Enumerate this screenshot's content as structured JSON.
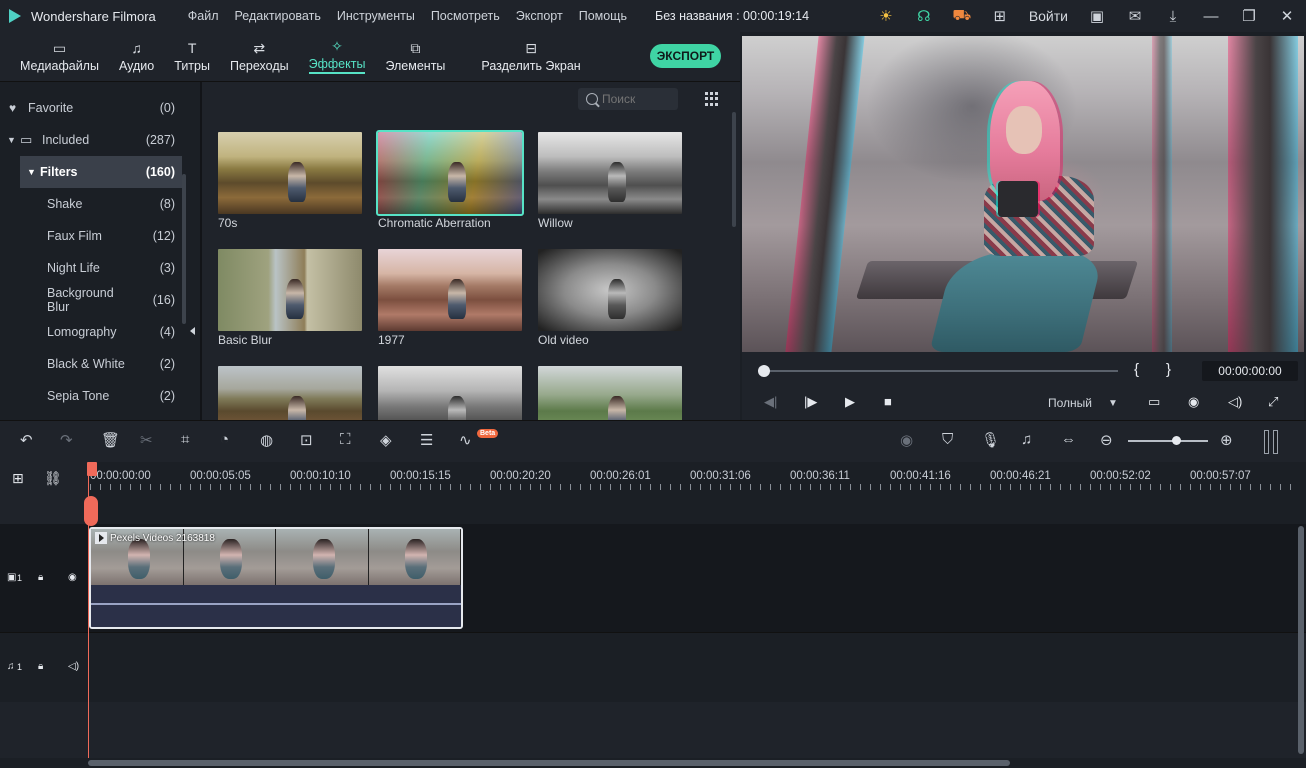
{
  "app": {
    "name": "Wondershare Filmora",
    "doc_title": "Без названия : 00:00:19:14",
    "login": "Войти"
  },
  "menu": [
    "Файл",
    "Редактировать",
    "Инструменты",
    "Посмотреть",
    "Экспорт",
    "Помощь"
  ],
  "tabs": [
    {
      "label": "Медиафайлы",
      "icon": "folder-icon"
    },
    {
      "label": "Аудио",
      "icon": "music-note-icon"
    },
    {
      "label": "Титры",
      "icon": "text-icon"
    },
    {
      "label": "Переходы",
      "icon": "transition-icon"
    },
    {
      "label": "Эффекты",
      "icon": "effects-icon",
      "active": true
    },
    {
      "label": "Элементы",
      "icon": "elements-icon"
    },
    {
      "label": "Разделить Экран",
      "icon": "split-screen-icon"
    }
  ],
  "export_label": "ЭКСПОРТ",
  "categories": [
    {
      "label": "Favorite",
      "count": "(0)"
    },
    {
      "label": "Included",
      "count": "(287)"
    },
    {
      "label": "Filters",
      "count": "(160)"
    },
    {
      "label": "Shake",
      "count": "(8)"
    },
    {
      "label": "Faux Film",
      "count": "(12)"
    },
    {
      "label": "Night Life",
      "count": "(3)"
    },
    {
      "label": "Background Blur",
      "count": "(16)"
    },
    {
      "label": "Lomography",
      "count": "(4)"
    },
    {
      "label": "Black & White",
      "count": "(2)"
    },
    {
      "label": "Sepia Tone",
      "count": "(2)"
    }
  ],
  "search": {
    "placeholder": "Поиск"
  },
  "effects": [
    "70s",
    "Chromatic Aberration",
    "Willow",
    "Basic Blur",
    "1977",
    "Old video"
  ],
  "preview": {
    "timecode": "00:00:00:00",
    "quality": "Полный",
    "brace_open": "{",
    "brace_close": "}"
  },
  "timeline": {
    "beta_label": "Beta",
    "ticks": [
      "00:00:00:00",
      "00:00:05:05",
      "00:00:10:10",
      "00:00:15:15",
      "00:00:20:20",
      "00:00:26:01",
      "00:00:31:06",
      "00:00:36:11",
      "00:00:41:16",
      "00:00:46:21",
      "00:00:52:02",
      "00:00:57:07"
    ],
    "video_track_label": "1",
    "audio_track_label": "1",
    "clip_name": "Pexels Videos 2163818"
  },
  "colors": {
    "accent": "#57e3c6",
    "export": "#3fd4a4",
    "playhead": "#f06a5a"
  }
}
